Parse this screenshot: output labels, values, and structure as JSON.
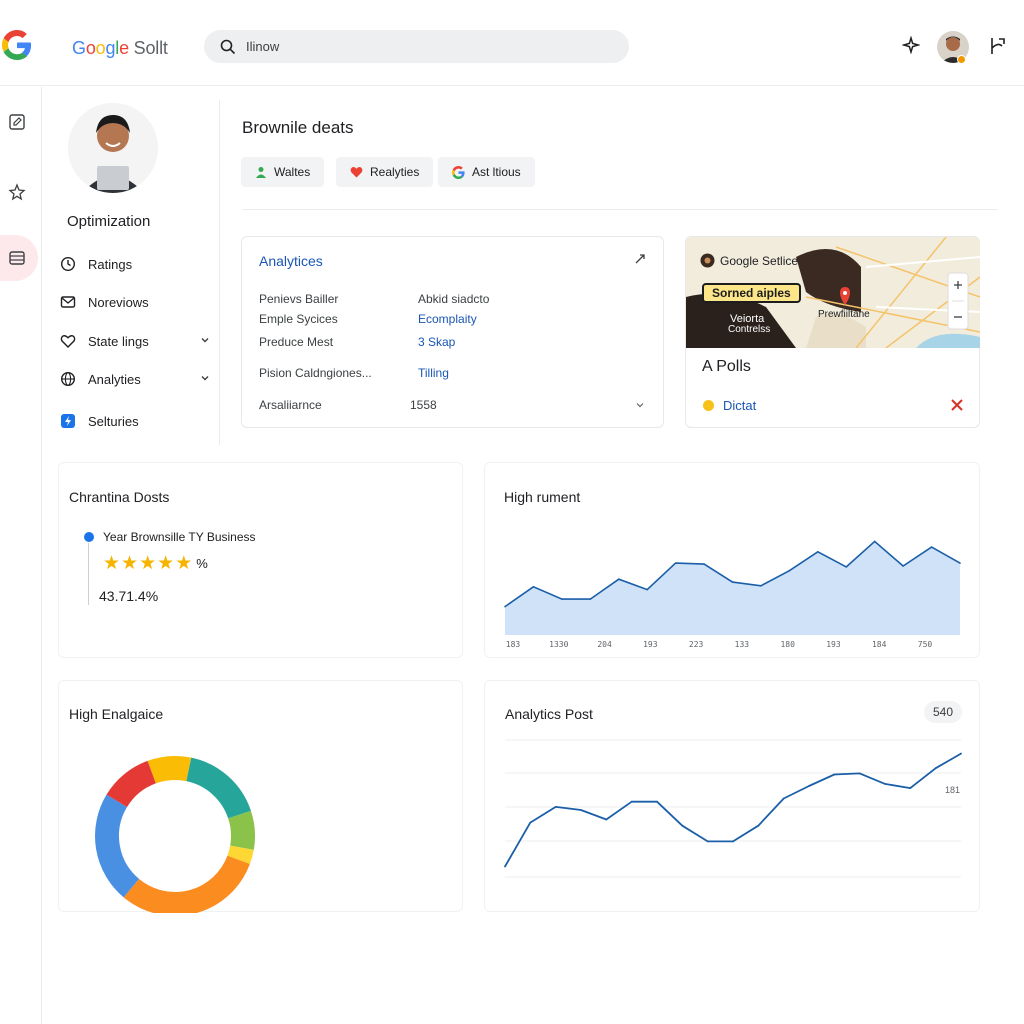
{
  "header": {
    "brand_letters": [
      "G",
      "o",
      "o",
      "g",
      "l",
      "e"
    ],
    "brand_rest": " Sollt",
    "search_text": "Ilinow"
  },
  "colors": {
    "google_blue": "#4285F4",
    "google_red": "#EA4335",
    "google_yellow": "#FBBC05",
    "google_green": "#34A853",
    "link_blue": "#1a56b3",
    "area_fill": "#cfe2f8",
    "line_blue": "#1b5fa8"
  },
  "icons": {
    "top": [
      "google-g-icon",
      "search-icon",
      "sparkle-icon",
      "avatar",
      "user-switch-icon"
    ],
    "rail": [
      "edit-square-icon",
      "star-outline-icon",
      "list-icon"
    ]
  },
  "sidebar": {
    "profile_name": "Optimization",
    "items": [
      {
        "label": "Ratings",
        "icon": "clock-icon"
      },
      {
        "label": "Noreviows",
        "icon": "mail-icon"
      },
      {
        "label": "State lings",
        "icon": "heart-icon",
        "expandable": true
      },
      {
        "label": "Analyties",
        "icon": "globe-icon",
        "expandable": true
      },
      {
        "label": "Selturies",
        "icon": "bolt-icon"
      }
    ]
  },
  "main": {
    "title": "Brownile deats",
    "chips": [
      {
        "label": "Waltes",
        "icon": "person-icon"
      },
      {
        "label": "Realyties",
        "icon": "heart-icon"
      },
      {
        "label": "Ast ltious",
        "icon": "google-g-icon"
      }
    ]
  },
  "analytics_card": {
    "title": "Analytices",
    "rows": [
      {
        "label": "Penievs Bailler",
        "value": "Abkid siadcto",
        "link": false
      },
      {
        "label": "Emple Sycices",
        "value": "Ecomplaity",
        "link": true
      },
      {
        "label": "Preduce Mest",
        "value": "3 Skap",
        "link": true
      },
      {
        "label": "Pision Caldngiones...",
        "value": "Tilling",
        "link": true
      },
      {
        "label": "Arsaliiarnce",
        "value": "1558",
        "link": false
      }
    ]
  },
  "map_card": {
    "overlay_title": "Google Setlice",
    "highlight": "Sorned aiples",
    "place_a": "Veiorta",
    "place_b": "Contrelss",
    "city": "Prewfiiltane",
    "title": "A  Polls",
    "status": "Dictat"
  },
  "rating_card": {
    "title": "Chrantina Dosts",
    "business": "Year Brownsille TY Business",
    "stars": 5,
    "percent_sign": "%",
    "score": "43.71.4%"
  },
  "area_card": {
    "title": "High rument"
  },
  "donut_card": {
    "title": "High Enalgaice"
  },
  "line_card": {
    "title": "Analytics Post",
    "badge": "540",
    "side_label": "181"
  },
  "chart_data": [
    {
      "type": "area",
      "title": "High rument",
      "x": [
        "183",
        "1330",
        "204",
        "193",
        "223",
        "133",
        "180",
        "193",
        "184",
        "750"
      ],
      "values": [
        30,
        51,
        38,
        38,
        59,
        48,
        76,
        75,
        56,
        52,
        68,
        88,
        72,
        99,
        73,
        93,
        76
      ],
      "ylim": [
        0,
        110
      ],
      "grid": false
    },
    {
      "type": "pie",
      "title": "High Enalgaice",
      "donut": true,
      "series": [
        {
          "value": 9,
          "color": "#FBBC05"
        },
        {
          "value": 17,
          "color": "#26a69a"
        },
        {
          "value": 8,
          "color": "#8bc34a"
        },
        {
          "value": 3,
          "color": "#fdd835"
        },
        {
          "value": 31,
          "color": "#fb8c1f"
        },
        {
          "value": 23,
          "color": "#4a90e2"
        },
        {
          "value": 11,
          "color": "#e53935"
        }
      ]
    },
    {
      "type": "line",
      "title": "Analytics Post",
      "values": [
        10,
        52,
        67,
        64,
        55,
        72,
        72,
        49,
        34,
        34,
        49,
        75,
        87,
        98,
        99,
        89,
        85,
        104,
        118
      ],
      "ylim": [
        0,
        130
      ],
      "grid": true
    }
  ]
}
